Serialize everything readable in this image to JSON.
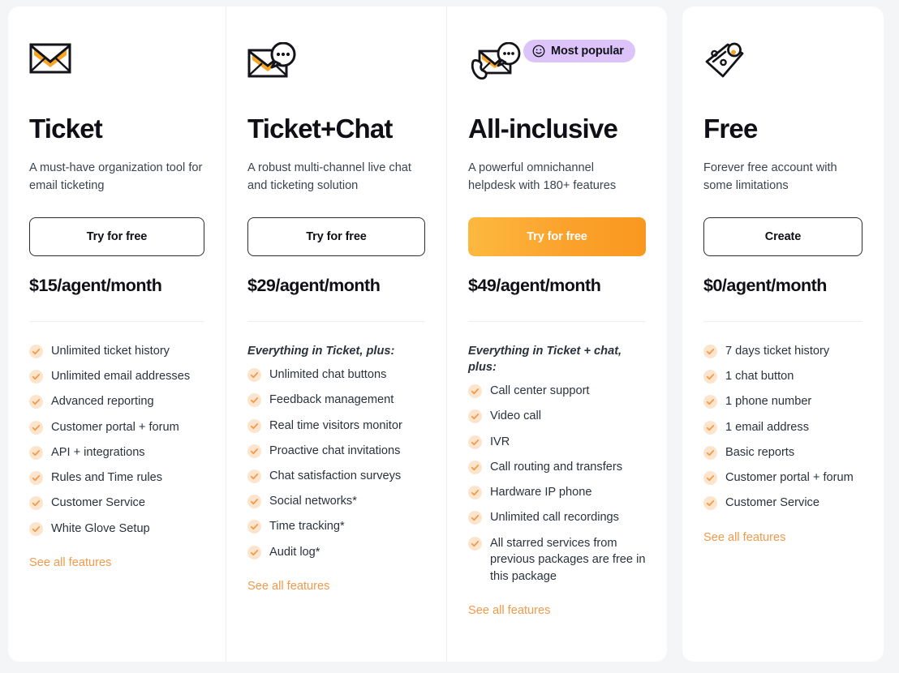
{
  "theme": {
    "page_bg": "#f4f5f7",
    "card_bg": "#ffffff",
    "accent_orange": "#f9981f",
    "link_orange": "#f2994a",
    "badge_purple": "#dcc4fa",
    "text_dark": "#0f0f15",
    "text_body": "#3c4450"
  },
  "plans": [
    {
      "id": "ticket",
      "icon": "envelope-icon",
      "name": "Ticket",
      "description": "A must-have organization tool for email ticketing",
      "cta_label": "Try for free",
      "cta_style": "outline",
      "price_amount": "$15",
      "price_period": "/agent/month",
      "features_intro": "",
      "features": [
        "Unlimited ticket history",
        "Unlimited email addresses",
        "Advanced reporting",
        "Customer portal + forum",
        "API + integrations",
        "Rules and Time rules",
        "Customer Service",
        "White Glove Setup"
      ],
      "see_all_label": "See all features",
      "badge": null
    },
    {
      "id": "ticket-chat",
      "icon": "envelope-chat-icon",
      "name": "Ticket+Chat",
      "description": "A robust multi-channel live chat and ticketing solution",
      "cta_label": "Try for free",
      "cta_style": "outline",
      "price_amount": "$29",
      "price_period": "/agent/month",
      "features_intro": "Everything in Ticket, plus:",
      "features": [
        "Unlimited chat buttons",
        "Feedback management",
        "Real time visitors monitor",
        "Proactive chat invitations",
        "Chat satisfaction surveys",
        "Social networks*",
        "Time tracking*",
        "Audit log*"
      ],
      "see_all_label": "See all features",
      "badge": null
    },
    {
      "id": "all-inclusive",
      "icon": "phone-envelope-chat-icon",
      "name": "All-inclusive",
      "description": "A powerful omnichannel helpdesk with 180+ features",
      "cta_label": "Try for free",
      "cta_style": "primary",
      "price_amount": "$49",
      "price_period": "/agent/month",
      "features_intro": "Everything in Ticket + chat, plus:",
      "features": [
        "Call center support",
        "Video call",
        "IVR",
        "Call routing and transfers",
        "Hardware IP phone",
        "Unlimited call recordings",
        "All starred services from previous packages are free in this package"
      ],
      "see_all_label": "See all features",
      "badge": {
        "label": "Most popular",
        "emoji": "smiley-face-icon"
      }
    },
    {
      "id": "free",
      "icon": "price-tag-percent-icon",
      "name": "Free",
      "description": "Forever free account with some limitations",
      "cta_label": "Create",
      "cta_style": "outline",
      "price_amount": "$0",
      "price_period": "/agent/month",
      "features_intro": "",
      "features": [
        "7 days ticket history",
        "1 chat button",
        "1 phone number",
        "1 email address",
        "Basic reports",
        "Customer portal + forum",
        "Customer Service"
      ],
      "see_all_label": "See all features",
      "badge": null
    }
  ]
}
